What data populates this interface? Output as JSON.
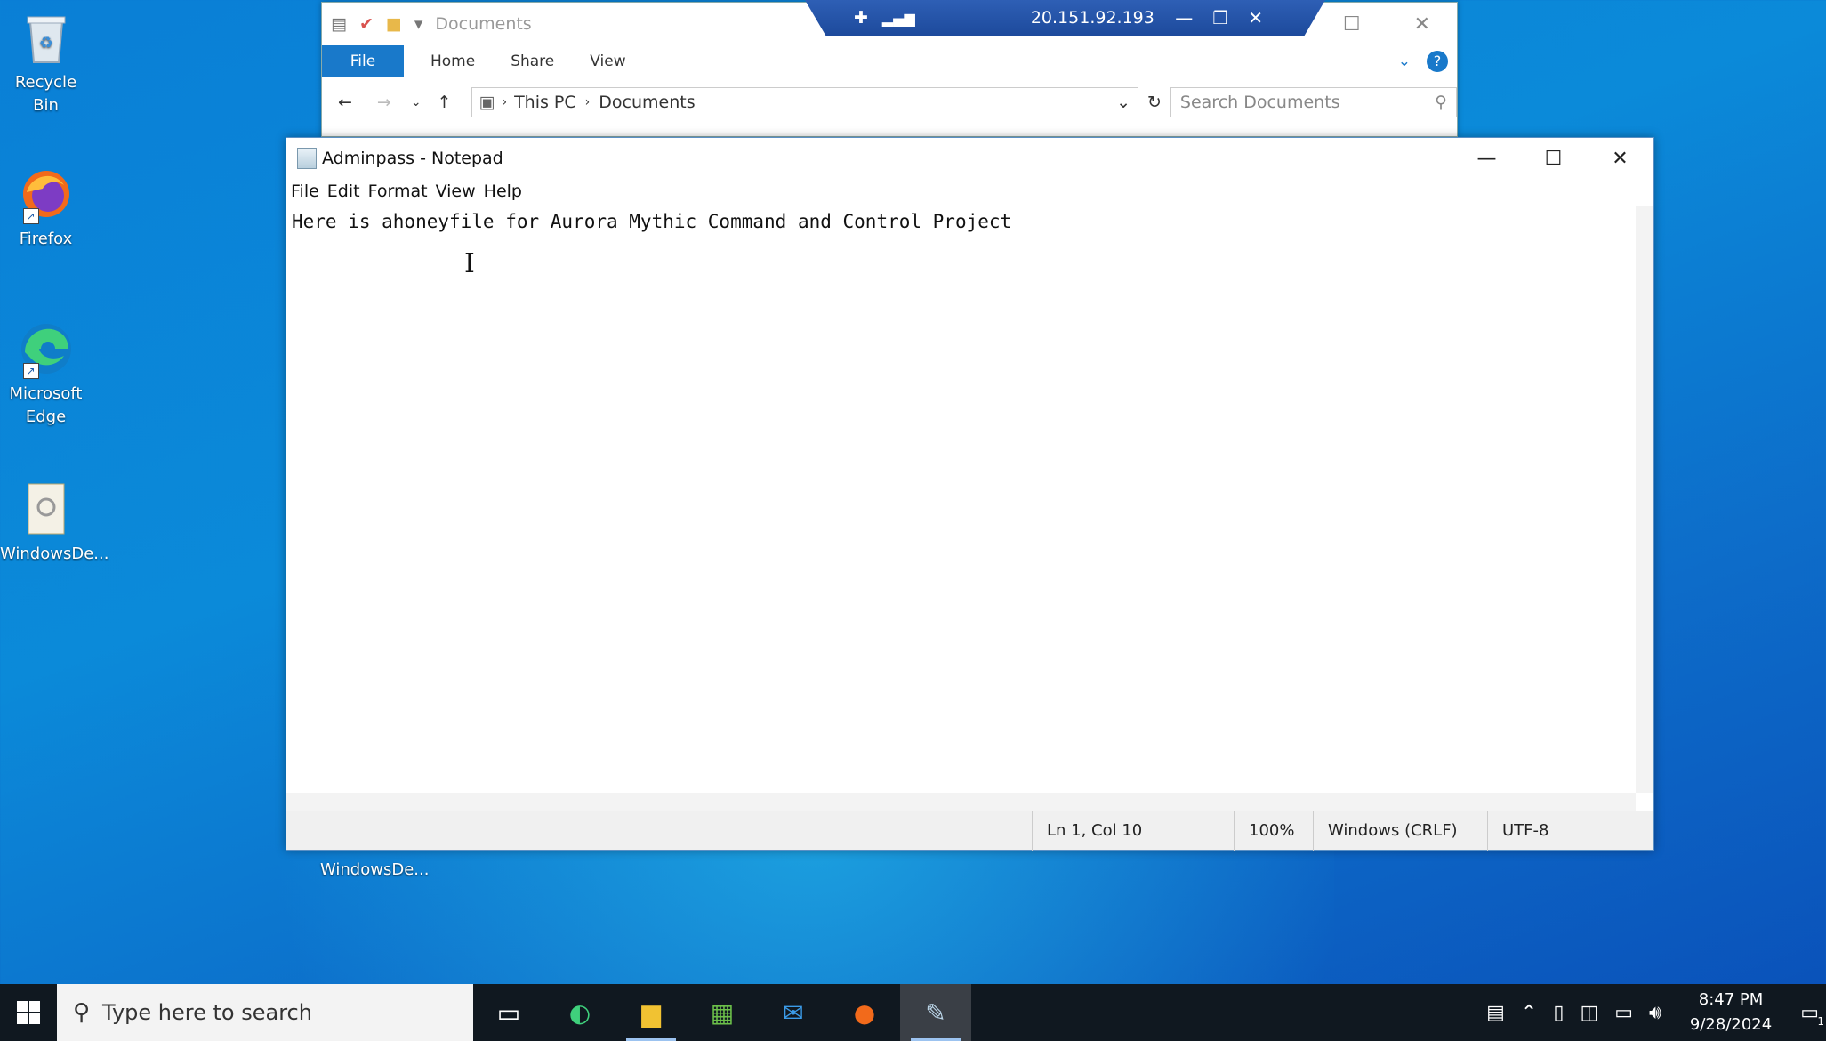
{
  "desktop": {
    "icons": [
      {
        "label": "Recycle Bin"
      },
      {
        "label": "Firefox"
      },
      {
        "label": "Microsoft Edge"
      },
      {
        "label": "WindowsDe..."
      }
    ],
    "hidden_icon_label": "WindowsDe..."
  },
  "explorer": {
    "title": "Documents",
    "tabs": {
      "file": "File",
      "home": "Home",
      "share": "Share",
      "view": "View"
    },
    "breadcrumb": {
      "root": "This PC",
      "folder": "Documents"
    },
    "search_placeholder": "Search Documents"
  },
  "rdp": {
    "host": "20.151.92.193"
  },
  "notepad": {
    "title": "Adminpass - Notepad",
    "menu": {
      "file": "File",
      "edit": "Edit",
      "format": "Format",
      "view": "View",
      "help": "Help"
    },
    "content": "Here is ahoneyfile for Aurora Mythic Command and Control Project",
    "status": {
      "position": "Ln 1, Col 10",
      "zoom": "100%",
      "line_ending": "Windows (CRLF)",
      "encoding": "UTF-8"
    }
  },
  "taskbar": {
    "search_placeholder": "Type here to search",
    "time": "8:47 PM",
    "date": "9/28/2024",
    "notification_count": "1"
  }
}
